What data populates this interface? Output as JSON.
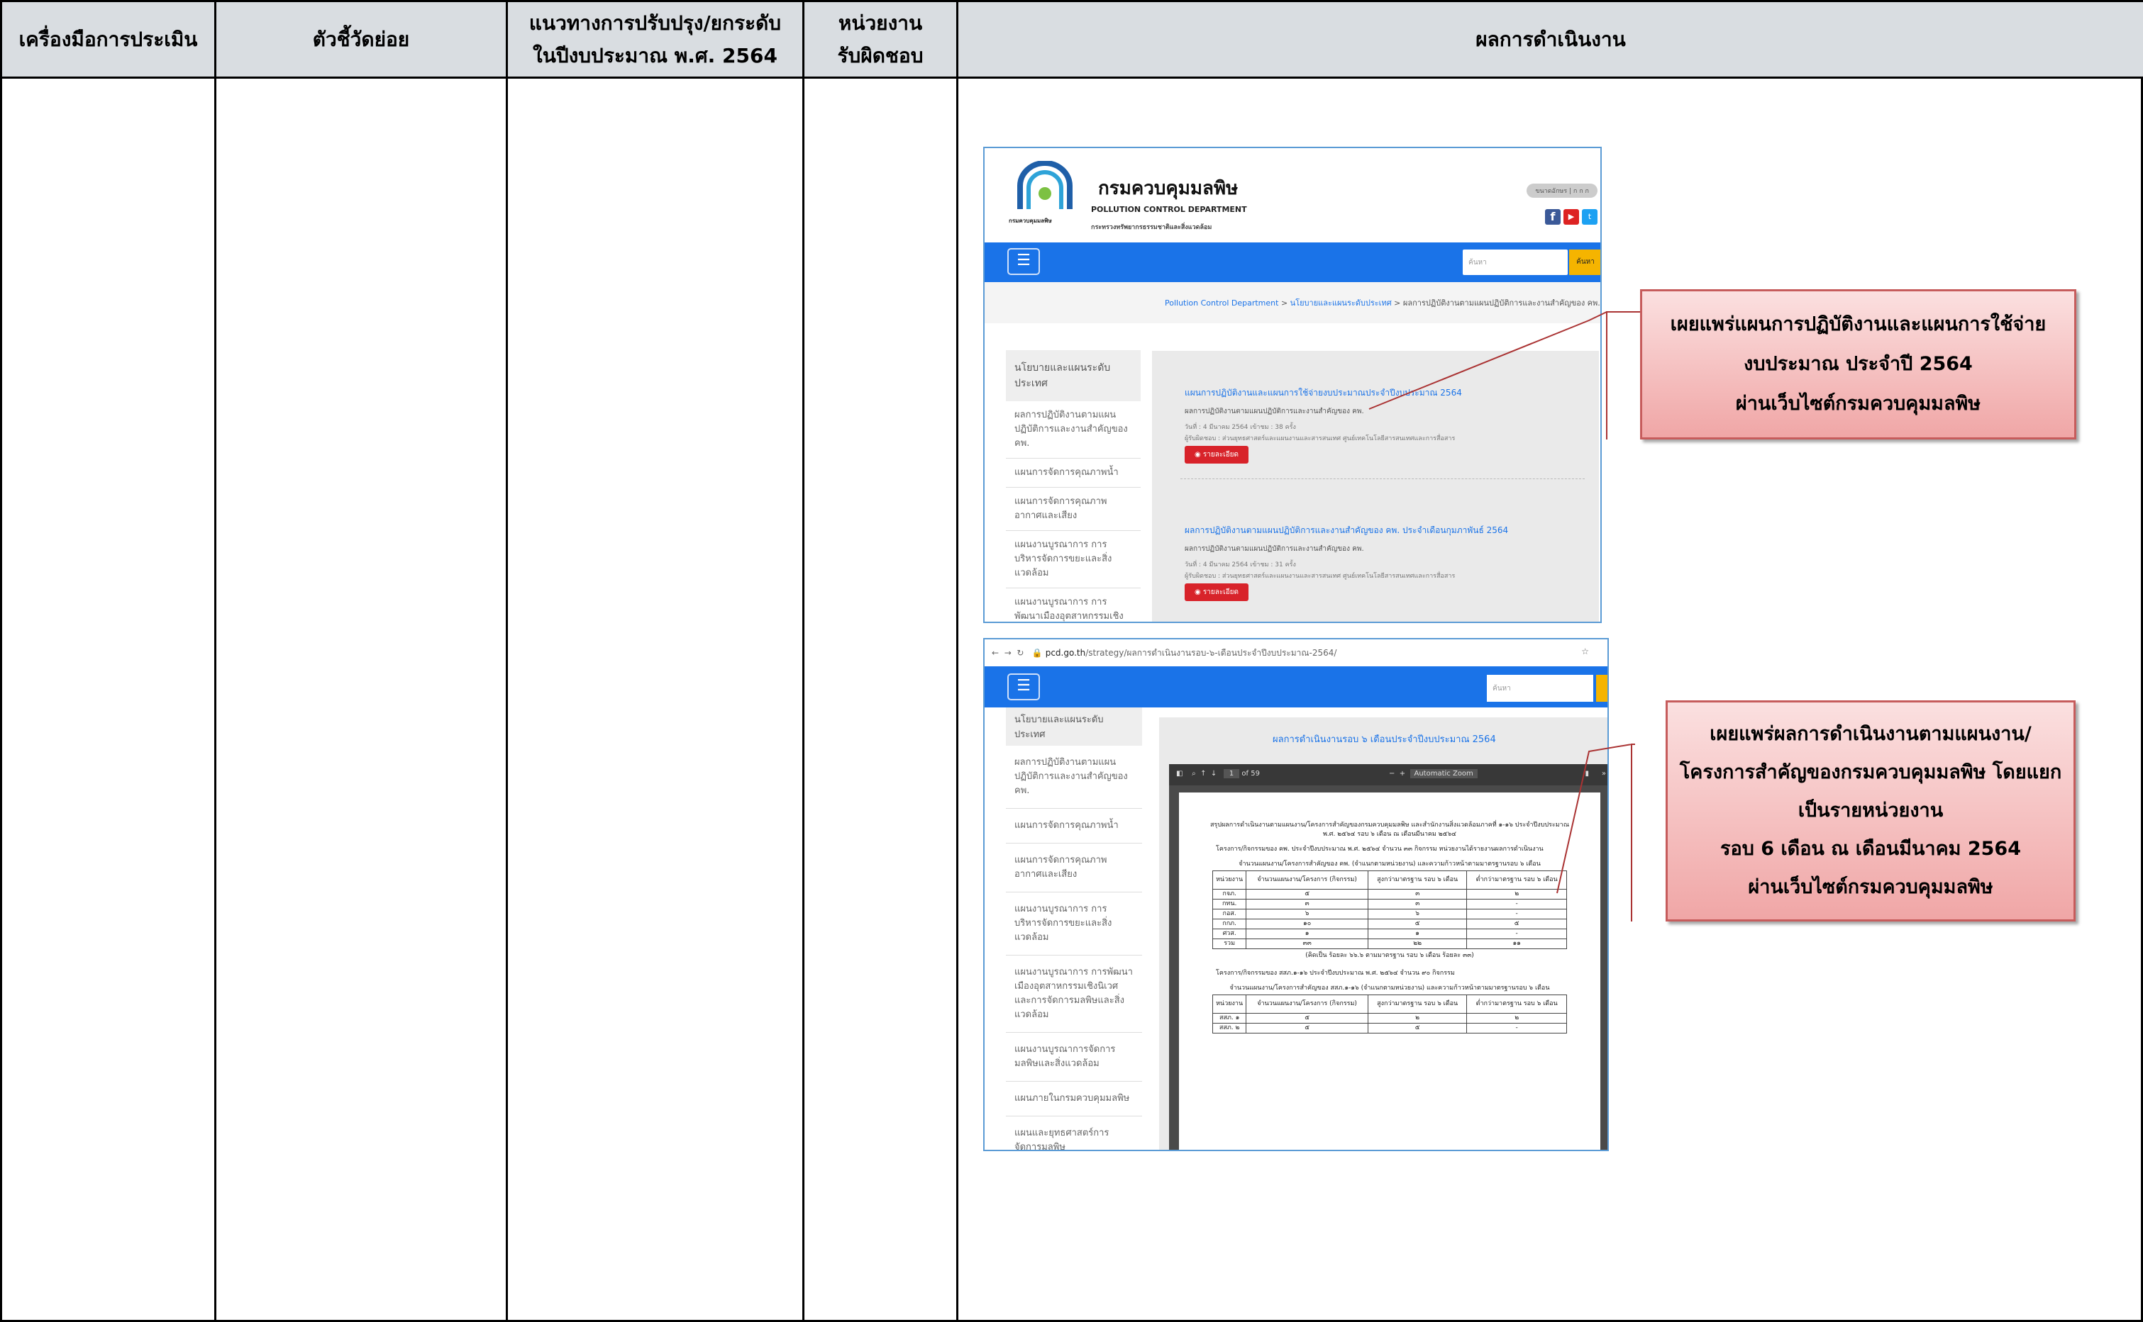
{
  "headers": {
    "h1": "เครื่องมือการประเมิน",
    "h2": "ตัวชี้วัดย่อย",
    "h3a": "แนวทางการปรับปรุง/ยกระดับ",
    "h3b": "ในปีงบประมาณ พ.ศ. 2564",
    "h4a": "หน่วยงาน",
    "h4b": "รับผิดชอบ",
    "h5": "ผลการดำเนินงาน"
  },
  "shot1": {
    "org_th": "กรมควบคุมมลพิษ",
    "org_en": "POLLUTION CONTROL DEPARTMENT",
    "ministry": "กระทรวงทรัพยากรธรรมชาติและสิ่งแวดล้อม",
    "font_size_label": "ขนาดอักษร",
    "search_placeholder": "ค้นหา",
    "search_button": "ค้นหา",
    "breadcrumb_1": "Pollution Control Department",
    "breadcrumb_2": "นโยบายและแผนระดับประเทศ",
    "breadcrumb_3": "ผลการปฏิบัติงานตามแผนปฏิบัติการและงานสำคัญของ คพ.",
    "sidebar_title": "นโยบายและแผนระดับประเทศ",
    "sidebar_items": [
      "ผลการปฏิบัติงานตามแผนปฏิบัติการและงานสำคัญของ คพ.",
      "แผนการจัดการคุณภาพน้ำ",
      "แผนการจัดการคุณภาพอากาศและเสียง",
      "แผนงานบูรณาการ การบริหารจัดการขยะและสิ่งแวดล้อม",
      "แผนงานบูรณาการ การพัฒนาเมืองอุตสาหกรรมเชิงนิเวศและ"
    ],
    "post1_title": "แผนการปฏิบัติงานและแผนการใช้จ่ายงบประมาณประจำปีงบประมาณ 2564",
    "post1_sub": "ผลการปฏิบัติงานตามแผนปฏิบัติการและงานสำคัญของ คพ.",
    "post1_meta": "วันที่ : 4 มีนาคม 2564    เข้าชม : 38 ครั้ง",
    "post1_meta2": "ผู้รับผิดชอบ : ส่วนยุทธศาสตร์และแผนงานและสารสนเทศ ศูนย์เทคโนโลยีสารสนเทศและการสื่อสาร",
    "post2_title": "ผลการปฏิบัติงานตามแผนปฏิบัติการและงานสำคัญของ คพ. ประจำเดือนกุมภาพันธ์ 2564",
    "post2_sub": "ผลการปฏิบัติงานตามแผนปฏิบัติการและงานสำคัญของ คพ.",
    "post2_meta": "วันที่ : 4 มีนาคม 2564    เข้าชม : 31 ครั้ง",
    "post2_meta2": "ผู้รับผิดชอบ : ส่วนยุทธศาสตร์และแผนงานและสารสนเทศ ศูนย์เทคโนโลยีสารสนเทศและการสื่อสาร",
    "detail_button": "รายละเอียด"
  },
  "shot2": {
    "url_host": "pcd.go.th",
    "url_path": "/strategy/ผลการดำเนินงานรอบ-๖-เดือนประจำปีงบประมาณ-2564/",
    "search_placeholder": "ค้นหา",
    "sidebar_title": "นโยบายและแผนระดับประเทศ",
    "sidebar_items": [
      "ผลการปฏิบัติงานตามแผนปฏิบัติการและงานสำคัญของ คพ.",
      "แผนการจัดการคุณภาพน้ำ",
      "แผนการจัดการคุณภาพอากาศและเสียง",
      "แผนงานบูรณาการ การบริหารจัดการขยะและสิ่งแวดล้อม",
      "แผนงานบูรณาการ การพัฒนาเมืองอุตสาหกรรมเชิงนิเวศและการจัดการมลพิษและสิ่งแวดล้อม",
      "แผนงานบูรณาการจัดการมลพิษและสิ่งแวดล้อม",
      "แผนภายในกรมควบคุมมลพิษ",
      "แผนและยุทธศาสตร์การจัดการมลพิษ"
    ],
    "page_title": "ผลการดำเนินงานรอบ ๖ เดือนประจำปีงบประมาณ 2564",
    "pdf_page": "1",
    "pdf_of": "of 59",
    "pdf_zoom": "Automatic Zoom",
    "pdf_heading": "สรุปผลการดำเนินงานตามแผนงาน/โครงการสำคัญของกรมควบคุมมลพิษ และสำนักงานสิ่งแวดล้อมภาคที่ ๑-๑๖ ประจำปีงบประมาณ พ.ศ. ๒๕๖๔ รอบ ๖ เดือน ณ เดือนมีนาคม ๒๕๖๔",
    "pdf_para": "โครงการ/กิจกรรมของ คพ. ประจำปีงบประมาณ พ.ศ. ๒๕๖๔ จำนวน ๓๓ กิจกรรม หน่วยงานได้รายงานผลการดำเนินงาน",
    "table_caption": "จำนวนแผนงาน/โครงการสำคัญของ คพ. (จำแนกตามหน่วยงาน) และความก้าวหน้าตามมาตรฐานรอบ ๖ เดือน",
    "table_headers": [
      "หน่วยงาน",
      "จำนวนแผนงาน/โครงการ (กิจกรรม)",
      "สูงกว่ามาตรฐาน รอบ ๖ เดือน",
      "ต่ำกว่ามาตรฐาน รอบ ๖ เดือน"
    ],
    "table_rows": [
      [
        "กจภ.",
        "๕",
        "๓",
        "๒"
      ],
      [
        "กทน.",
        "๓",
        "๓",
        "-"
      ],
      [
        "กอส.",
        "๖",
        "๖",
        "-"
      ],
      [
        "กกภ.",
        "๑๐",
        "๕",
        "๕"
      ],
      [
        "ศวส.",
        "๑",
        "๑",
        "-"
      ],
      [
        "รวม",
        "๓๓",
        "๒๒",
        "๑๑"
      ]
    ],
    "table_note": "(คิดเป็น ร้อยละ ๖๖.๖ ตามมาตรฐาน รอบ ๖ เดือน ร้อยละ ๓๓)",
    "pdf_para2": "โครงการ/กิจกรรมของ สสภ.๑-๑๖ ประจำปีงบประมาณ พ.ศ. ๒๕๖๔ จำนวน ๙๐ กิจกรรม",
    "table2_caption": "จำนวนแผนงาน/โครงการสำคัญของ สสภ.๑-๑๖ (จำแนกตามหน่วยงาน) และความก้าวหน้าตามมาตรฐานรอบ ๖ เดือน",
    "table2_rows": [
      [
        "สสภ. ๑",
        "๕",
        "๒",
        "๒"
      ],
      [
        "สสภ. ๒",
        "๕",
        "๕",
        "-"
      ]
    ]
  },
  "callouts": {
    "c1": [
      "เผยแพร่แผนการปฏิบัติงานและแผนการใช้จ่าย",
      "งบประมาณ ประจำปี 2564",
      "ผ่านเว็บไซต์กรมควบคุมมลพิษ"
    ],
    "c2": [
      "เผยแพร่ผลการดำเนินงานตามแผนงาน/",
      "โครงการสำคัญของกรมควบคุมมลพิษ โดยแยก",
      "เป็นรายหน่วยงาน",
      "รอบ 6 เดือน ณ เดือนมีนาคม 2564",
      "ผ่านเว็บไซต์กรมควบคุมมลพิษ"
    ]
  },
  "colors": {
    "header_bg": "#d9dde1",
    "site_blue": "#1a73e8",
    "callout_border": "#c65c5c",
    "accent_red": "#d8232a"
  }
}
